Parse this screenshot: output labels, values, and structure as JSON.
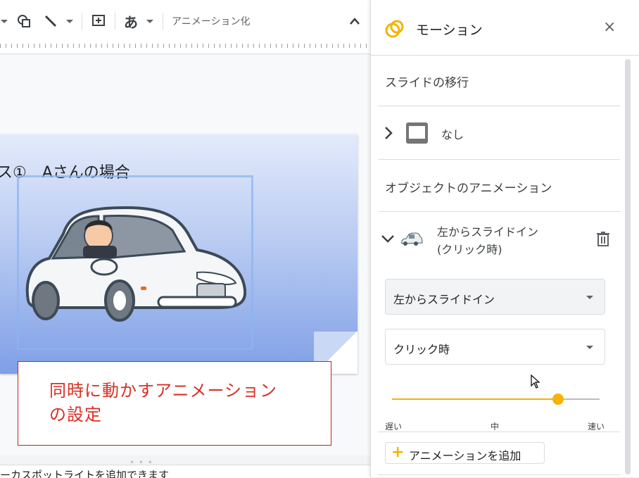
{
  "toolbar": {
    "animate_label": "アニメーション化",
    "text_style_glyph": "あ"
  },
  "slide": {
    "title": "ス①　Aさんの場合",
    "callout": [
      "同時に動かすアニメーション",
      "の設定"
    ]
  },
  "notes": {
    "text": "ーカスポットライトを追加できます"
  },
  "panel": {
    "title": "モーション",
    "close_glyph": "×",
    "slide_transition": {
      "heading": "スライドの移行",
      "value": "なし"
    },
    "object_animation": {
      "heading": "オブジェクトのアニメーション",
      "item_title": "左からスライドイン",
      "item_subtitle": "(クリック時)",
      "effect_select": "左からスライドイン",
      "trigger_select": "クリック時",
      "speed": {
        "fraction": 0.8,
        "ticks": [
          "遅い",
          "中",
          "速い"
        ]
      }
    },
    "add_button_label": "アニメーションを追加",
    "add_button_glyph": "+"
  },
  "colors": {
    "accent": "#f4b400",
    "callout_text": "#d93025",
    "callout_border": "#c5221f"
  },
  "icons": [
    "chevron-down-icon",
    "shape-icon",
    "line-icon",
    "add-comment-icon",
    "collapse-up-icon",
    "motion-icon",
    "close-icon",
    "chevron-right-icon",
    "slide-thumbnail-icon",
    "chevron-down-icon",
    "car-thumbnail-icon",
    "trash-icon",
    "plus-icon",
    "mouse-pointer-icon"
  ]
}
